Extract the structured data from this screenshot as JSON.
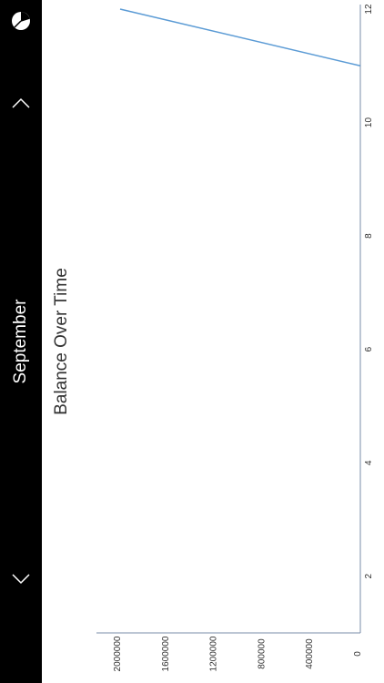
{
  "sidebar": {
    "month": "September",
    "menu_icon": "pie-chart-icon",
    "prev_icon": "chevron-up-icon",
    "next_icon": "chevron-down-icon"
  },
  "chart_data": {
    "type": "line",
    "title": "Balance Over Time",
    "xlabel": "",
    "ylabel": "",
    "x_ticks": [
      "2",
      "4",
      "6",
      "8",
      "10",
      "12"
    ],
    "y_ticks": [
      "0",
      "400000",
      "800000",
      "1200000",
      "1600000",
      "2000000"
    ],
    "xlim": [
      1,
      12
    ],
    "ylim": [
      0,
      2100000
    ],
    "series": [
      {
        "x": [
          11,
          12
        ],
        "values": [
          0,
          2000000
        ]
      }
    ],
    "line_color": "#5b9bd5",
    "grid": false,
    "legend": "none"
  }
}
